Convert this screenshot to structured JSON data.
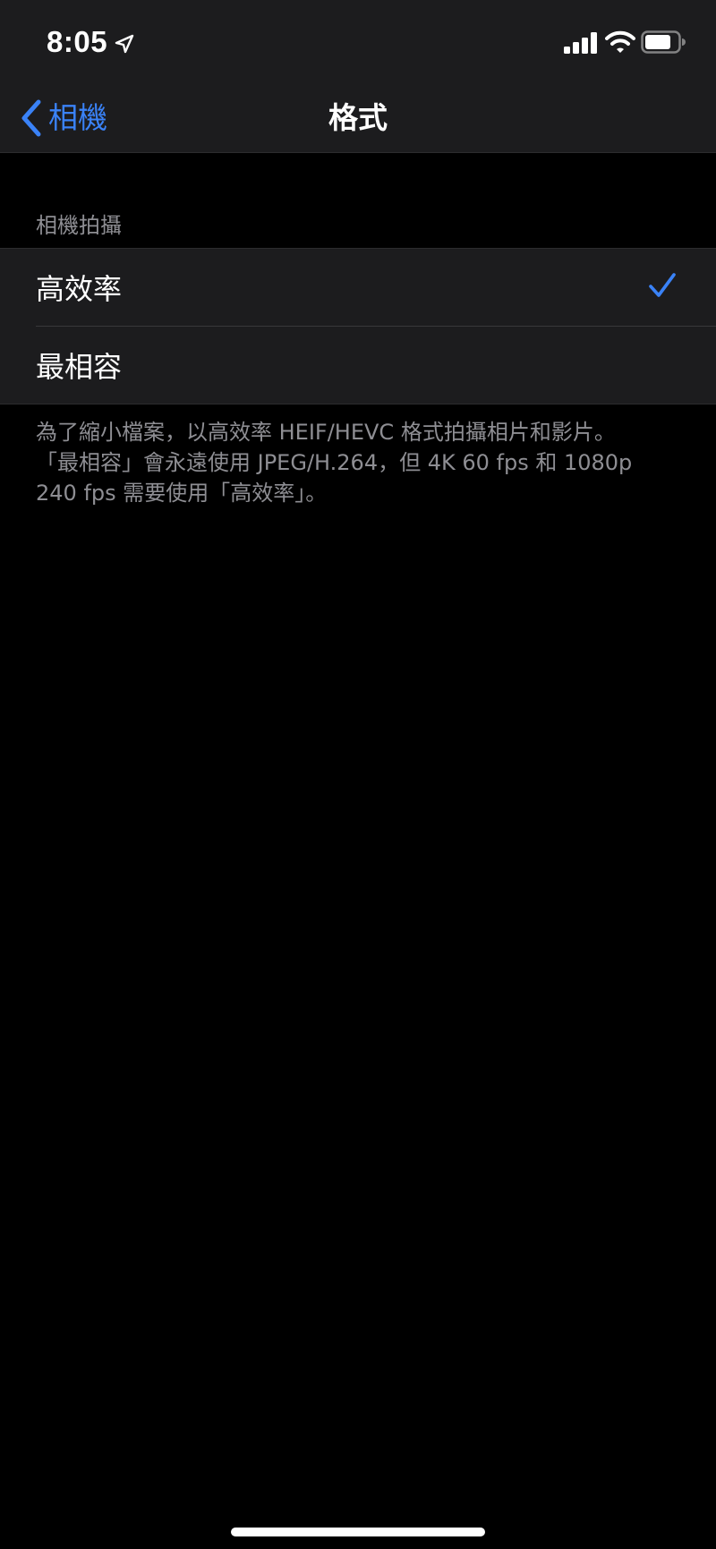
{
  "status_bar": {
    "time": "8:05",
    "icons": [
      "location-arrow-icon",
      "cellular-signal-icon",
      "wifi-icon",
      "battery-icon"
    ]
  },
  "nav": {
    "back_label": "相機",
    "title": "格式"
  },
  "section": {
    "header": "相機拍攝",
    "options": [
      {
        "label": "高效率",
        "selected": true
      },
      {
        "label": "最相容",
        "selected": false
      }
    ]
  },
  "footer": {
    "lines": [
      "為了縮小檔案，以高效率 HEIF/HEVC 格式拍攝相片和影片。",
      "「最相容」會永遠使用 JPEG/H.264，但 4K 60 fps 和 1080p",
      "240 fps 需要使用「高效率」。"
    ]
  },
  "colors": {
    "accent": "#3a82f7",
    "background": "#000000",
    "cell_background": "#1c1c1e",
    "secondary_text": "#8e8e93"
  }
}
